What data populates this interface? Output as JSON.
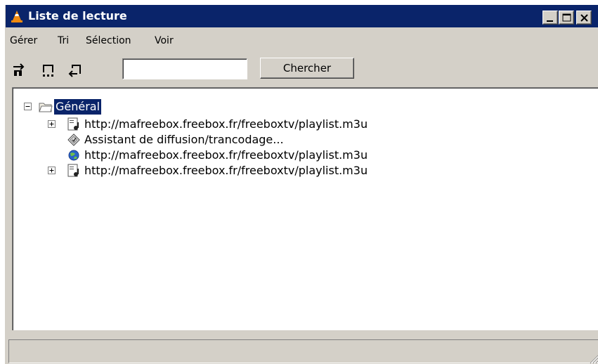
{
  "window": {
    "title": "Liste de lecture",
    "controls": [
      "minimize",
      "maximize",
      "close"
    ]
  },
  "menubar": {
    "items": [
      "Gérer",
      "Tri",
      "Sélection",
      "Voir"
    ]
  },
  "toolbar": {
    "icons": [
      "playlist-add-icon",
      "playlist-edit-icon",
      "playlist-remove-icon"
    ],
    "search": {
      "value": "",
      "button_label": "Chercher"
    }
  },
  "tree": {
    "root": {
      "label": "Général",
      "icon": "folder-icon",
      "expanded": true,
      "selected": true
    },
    "items": [
      {
        "label": "http://mafreebox.freebox.fr/freeboxtv/playlist.m3u",
        "icon": "playlist-file-icon",
        "expandable": true
      },
      {
        "label": "Assistant de diffusion/trancodage...",
        "icon": "streaming-wizard-icon",
        "expandable": false
      },
      {
        "label": "http://mafreebox.freebox.fr/freeboxtv/playlist.m3u",
        "icon": "network-globe-icon",
        "expandable": false
      },
      {
        "label": "http://mafreebox.freebox.fr/freeboxtv/playlist.m3u",
        "icon": "playlist-file-icon",
        "expandable": true
      }
    ]
  },
  "statusbar": {
    "text": ""
  },
  "colors": {
    "titlebar": "#0a246a",
    "face": "#d4d0c8",
    "selection": "#0a246a"
  }
}
